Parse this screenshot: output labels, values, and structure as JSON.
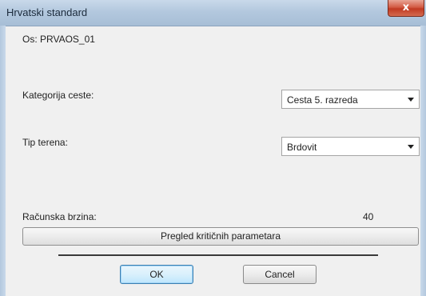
{
  "window": {
    "title": "Hrvatski standard",
    "close_glyph": "x"
  },
  "os_label": "Os: PRVAOS_01",
  "kategorija": {
    "label": "Kategorija ceste:",
    "value": "Cesta 5. razreda"
  },
  "teren": {
    "label": "Tip terena:",
    "value": "Brdovit"
  },
  "brzina": {
    "label": "Računska brzina:",
    "value": "40"
  },
  "buttons": {
    "pregled": "Pregled kritičnih parametara",
    "ok": "OK",
    "cancel": "Cancel"
  },
  "icons": {
    "close": "close-icon",
    "dropdown": "chevron-down-icon"
  }
}
